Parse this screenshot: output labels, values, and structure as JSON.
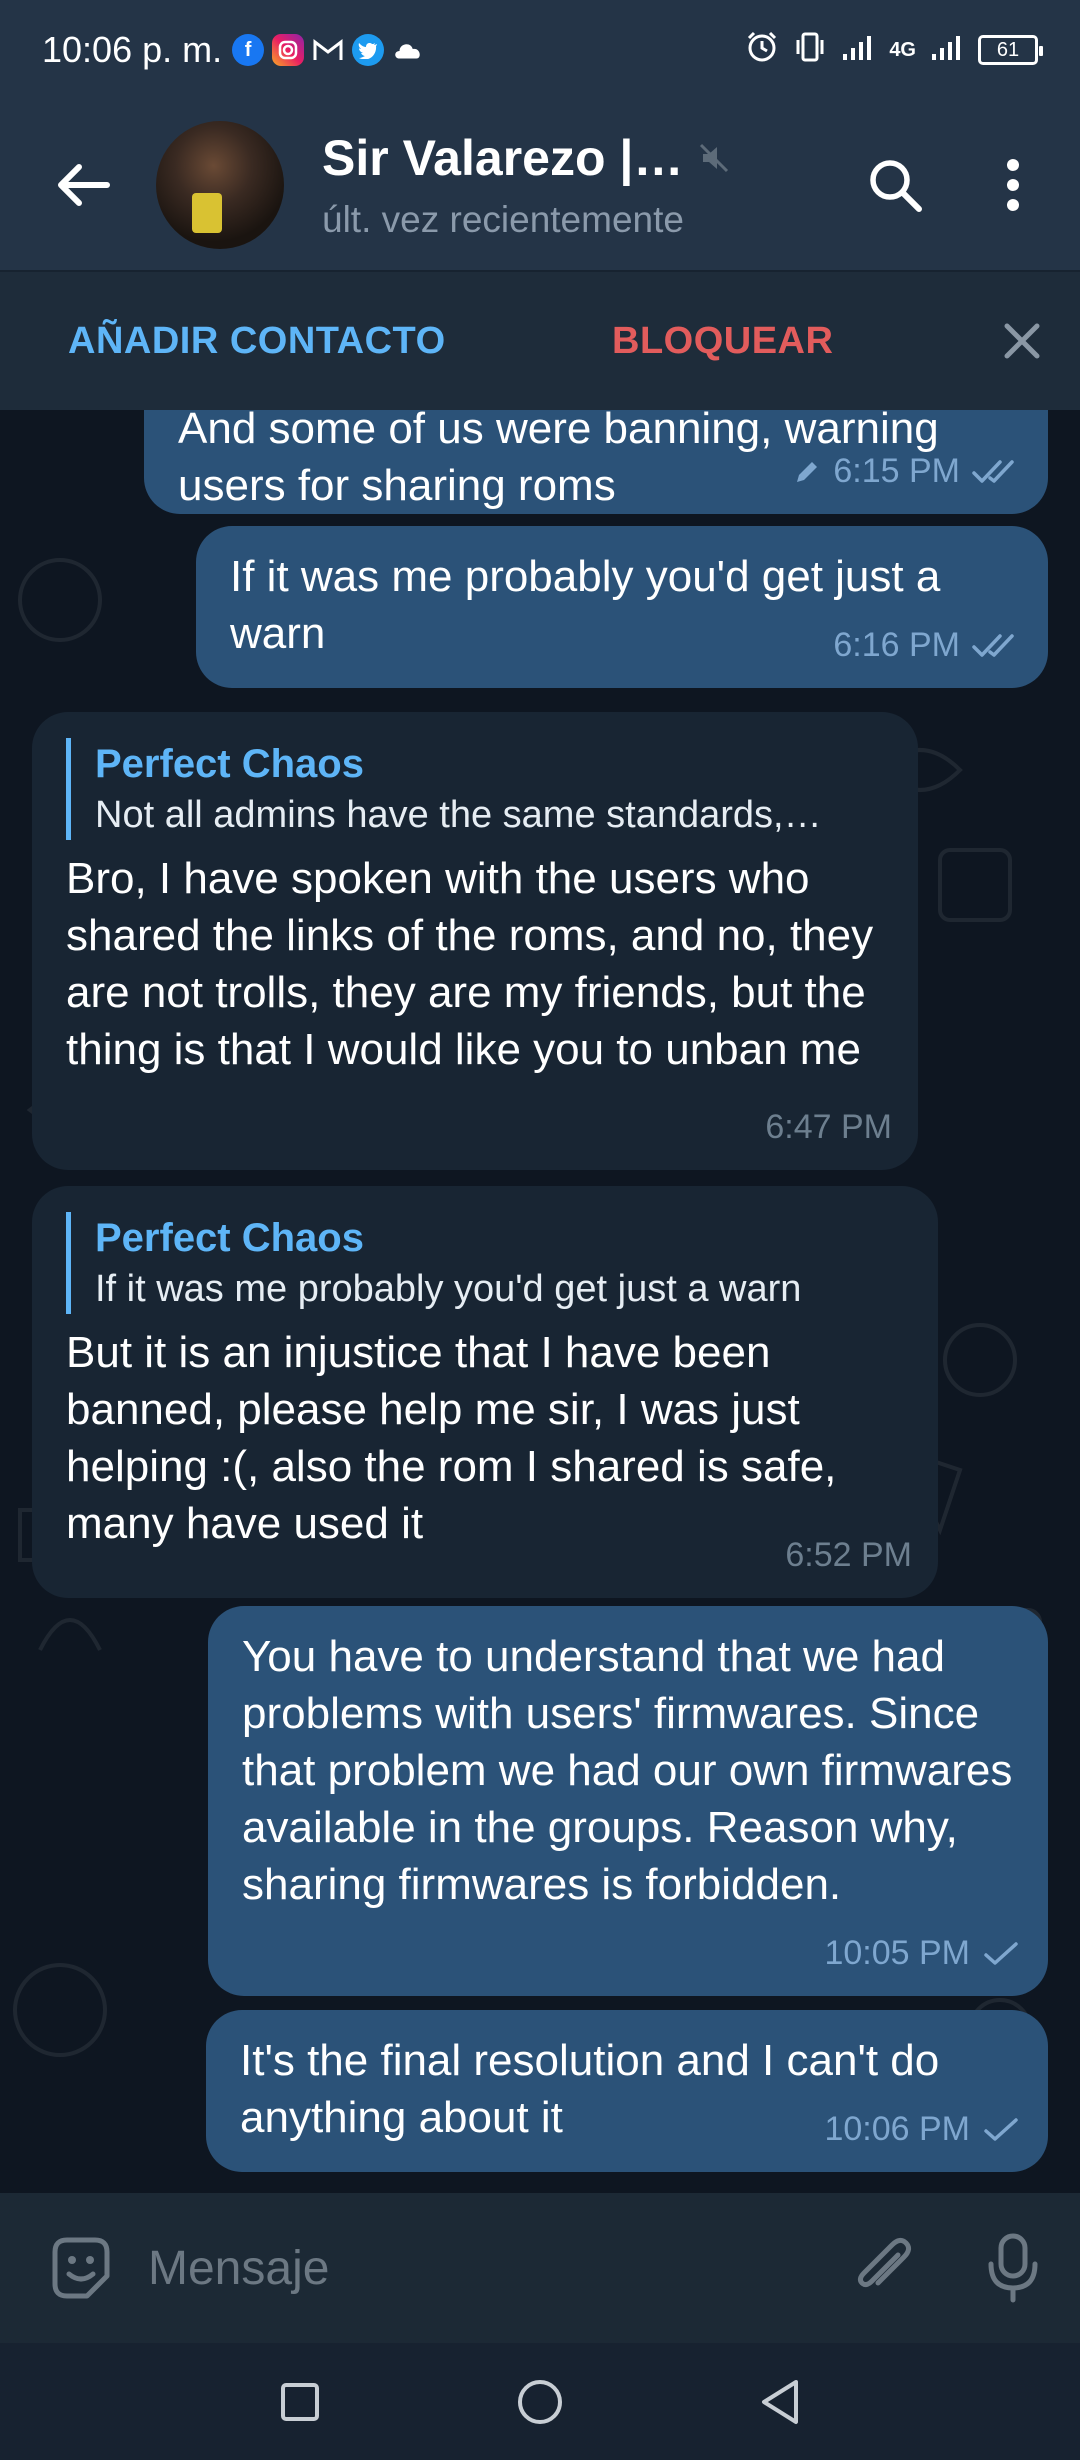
{
  "status_bar": {
    "time": "10:06 p. m.",
    "network": "4G",
    "battery": "61",
    "app_icons": [
      "facebook-icon",
      "instagram-icon",
      "gmail-icon",
      "twitter-icon",
      "cloud-icon"
    ]
  },
  "header": {
    "contact_name": "Sir Valarezo |…",
    "last_seen": "últ. vez recientemente",
    "muted": true
  },
  "action_bar": {
    "add_contact": "AÑADIR CONTACTO",
    "block": "BLOQUEAR"
  },
  "messages": [
    {
      "direction": "out",
      "text": "And some of us were banning, warning users for sharing roms",
      "time": "6:15 PM",
      "edited": true,
      "status": "read"
    },
    {
      "direction": "out",
      "text": "If it was me probably you'd get just a warn",
      "time": "6:16 PM",
      "status": "read"
    },
    {
      "direction": "in",
      "reply_name": "Perfect Chaos",
      "reply_text": "Not all admins have the same standards,…",
      "text": "Bro, I have spoken with the users who shared the links of the roms, and no, they are not trolls, they are my friends, but the thing is that I would like you to unban me",
      "time": "6:47 PM"
    },
    {
      "direction": "in",
      "reply_name": "Perfect Chaos",
      "reply_text": "If it was me probably you'd get just a warn",
      "text": "But it is an injustice that I have been banned, please help me sir, I was just helping :(, also the rom I shared is safe, many have used it",
      "time": "6:52 PM"
    },
    {
      "direction": "out",
      "text": "You have to understand that we had problems with users' firmwares. Since that problem we had our own firmwares available in the groups. Reason why, sharing firmwares is forbidden.",
      "time": "10:05 PM",
      "status": "sent"
    },
    {
      "direction": "out",
      "text": "It's the final resolution and I can't do anything about it",
      "time": "10:06 PM",
      "status": "sent"
    }
  ],
  "composer": {
    "placeholder": "Mensaje"
  },
  "colors": {
    "header_bg": "#243447",
    "chat_bg": "#0e1621",
    "outgoing_bubble": "#2b5278",
    "incoming_bubble": "#182533",
    "accent": "#5eb5f7",
    "danger": "#e25c5c"
  }
}
